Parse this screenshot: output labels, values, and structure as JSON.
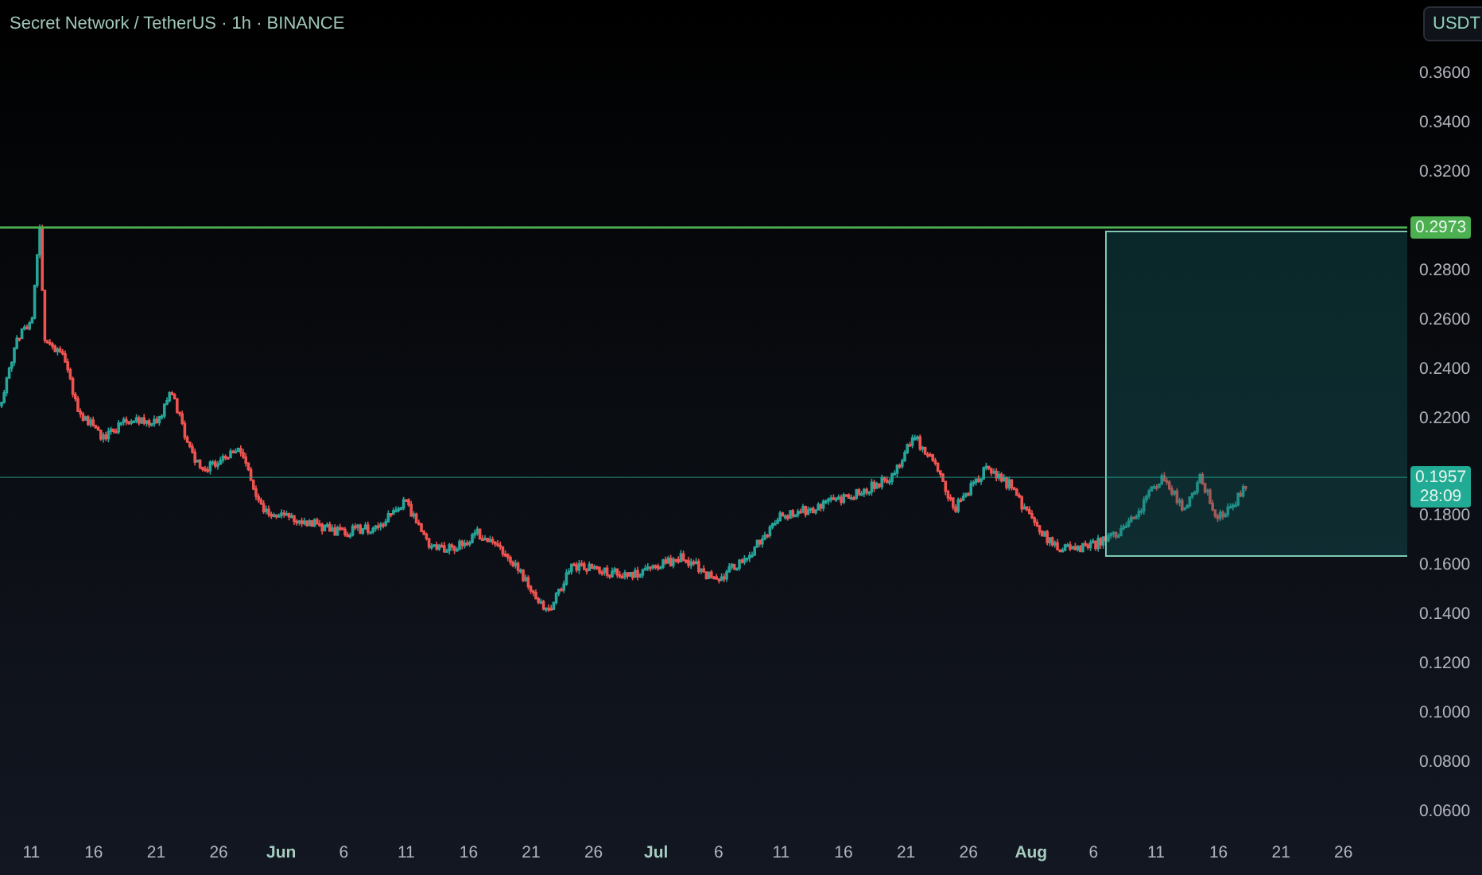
{
  "header": {
    "title": "Secret Network / TetherUS · 1h · BINANCE"
  },
  "currency_button": {
    "label": "USDT"
  },
  "price_axis": {
    "labels": [
      "0.3600",
      "0.3400",
      "0.3200",
      "0.2800",
      "0.2600",
      "0.2400",
      "0.2200",
      "0.1800",
      "0.1600",
      "0.1400",
      "0.1200",
      "0.1000",
      "0.0800",
      "0.0600"
    ]
  },
  "markers": [
    {
      "kind": "level",
      "label": "0.2973",
      "color": "#4caf50"
    },
    {
      "kind": "last",
      "label": "0.1957",
      "countdown": "28:09",
      "color": "#22ab94"
    }
  ],
  "time_axis": {
    "labels": [
      {
        "label": "11",
        "kind": "day"
      },
      {
        "label": "16",
        "kind": "day"
      },
      {
        "label": "21",
        "kind": "day"
      },
      {
        "label": "26",
        "kind": "day"
      },
      {
        "label": "Jun",
        "kind": "month"
      },
      {
        "label": "6",
        "kind": "day"
      },
      {
        "label": "11",
        "kind": "day"
      },
      {
        "label": "16",
        "kind": "day"
      },
      {
        "label": "21",
        "kind": "day"
      },
      {
        "label": "26",
        "kind": "day"
      },
      {
        "label": "Jul",
        "kind": "month"
      },
      {
        "label": "6",
        "kind": "day"
      },
      {
        "label": "11",
        "kind": "day"
      },
      {
        "label": "16",
        "kind": "day"
      },
      {
        "label": "21",
        "kind": "day"
      },
      {
        "label": "26",
        "kind": "day"
      },
      {
        "label": "Aug",
        "kind": "month"
      },
      {
        "label": "6",
        "kind": "day"
      },
      {
        "label": "11",
        "kind": "day"
      },
      {
        "label": "16",
        "kind": "day"
      },
      {
        "label": "21",
        "kind": "day"
      },
      {
        "label": "26",
        "kind": "day"
      }
    ]
  }
}
